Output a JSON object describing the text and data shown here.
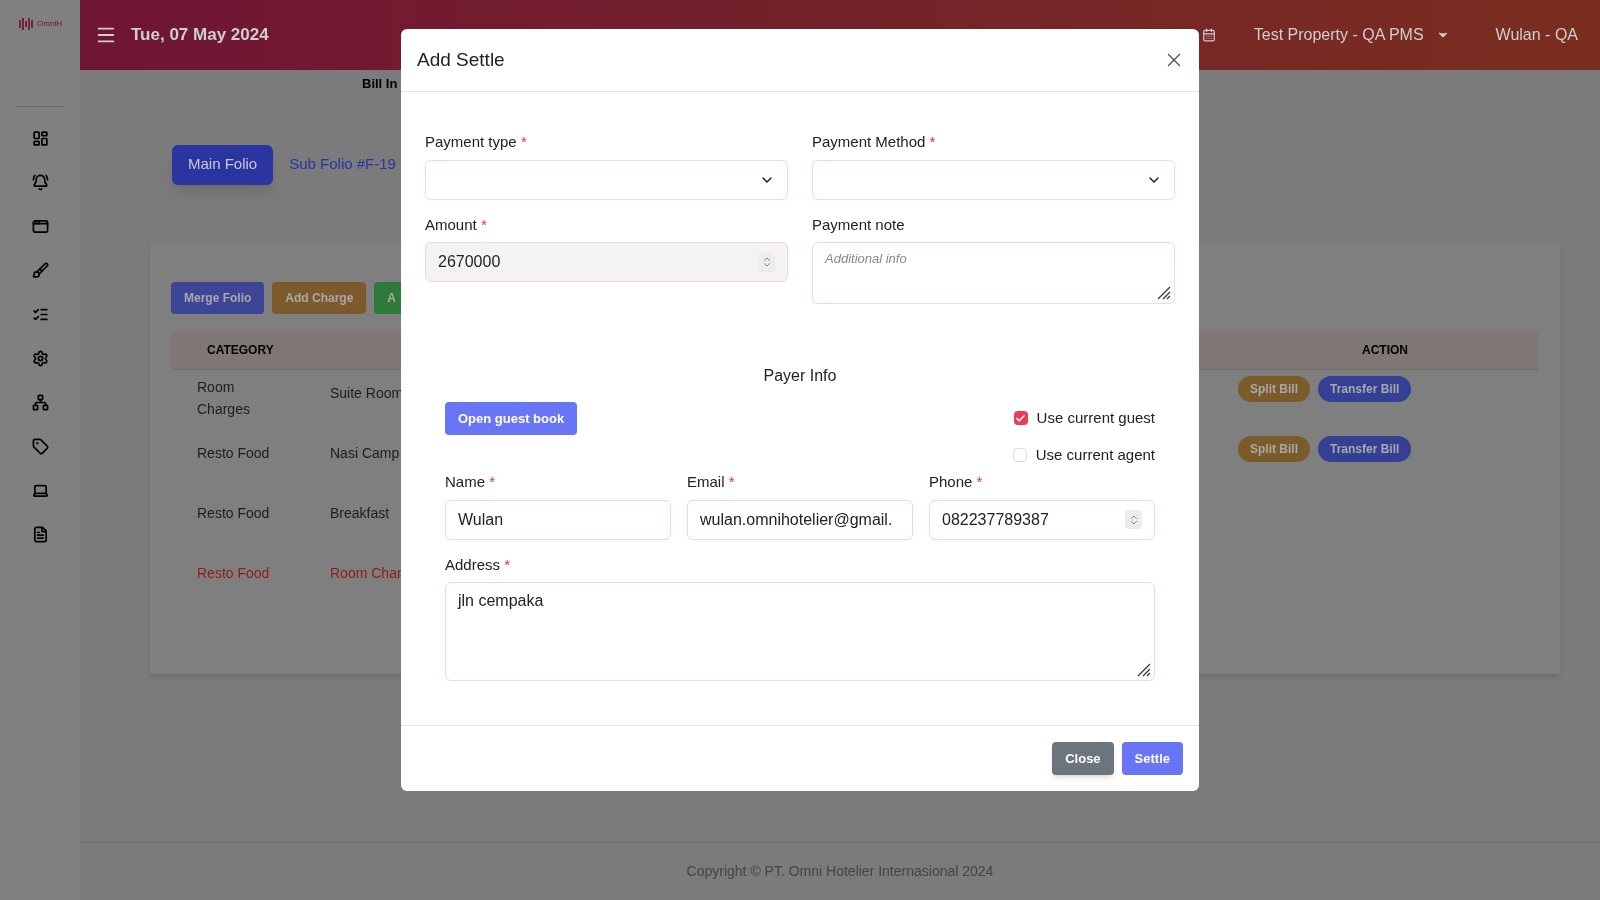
{
  "brand": {
    "logo_text": "OmniH"
  },
  "topbar": {
    "date": "Tue, 07 May 2024",
    "property": "Test Property - QA PMS",
    "user": "Wulan - QA"
  },
  "page": {
    "breadcrumb": "Bill In",
    "folio_tabs": [
      {
        "label": "Main Folio",
        "selected": true
      },
      {
        "label": "Sub Folio #F-19",
        "selected": false
      }
    ],
    "actions": [
      {
        "label": "Merge Folio",
        "color": "#3e4596"
      },
      {
        "label": "Add Charge",
        "color": "#7d5a2c"
      },
      {
        "label": "A",
        "color": "#2e7a3a"
      }
    ],
    "table": {
      "columns": [
        "CATEGORY",
        "ACTION"
      ],
      "rows": [
        {
          "category": "Room Charges",
          "item": "Suite Room",
          "alert": false,
          "actions": [
            {
              "label": "Split Bill",
              "color": "#7b5b2a"
            },
            {
              "label": "Transfer Bill",
              "color": "#353f94"
            }
          ]
        },
        {
          "category": "Resto Food",
          "item": "Nasi Camp",
          "alert": false,
          "actions": [
            {
              "label": "Split Bill",
              "color": "#7b5b2a"
            },
            {
              "label": "Transfer Bill",
              "color": "#353f94"
            }
          ]
        },
        {
          "category": "Resto Food",
          "item": "Breakfast",
          "alert": false,
          "actions": []
        },
        {
          "category": "Resto Food",
          "item": "Room Char",
          "alert": true,
          "actions": []
        }
      ]
    }
  },
  "modal": {
    "title": "Add Settle",
    "fields": [
      {
        "kind": "select",
        "label": "Payment type",
        "mark": "*"
      },
      {
        "kind": "select",
        "label": "Payment Method",
        "mark": "*"
      },
      {
        "kind": "number",
        "label": "Amount",
        "mark": "*",
        "value": "2670000"
      },
      {
        "kind": "textarea",
        "label": "Payment note",
        "placeholder": "Additional info"
      }
    ],
    "payer": {
      "title": "Payer Info",
      "guest_book_button": "Open guest book",
      "checkboxes": [
        {
          "label": "Use current guest",
          "checked": true
        },
        {
          "label": "Use current agent",
          "checked": false
        }
      ],
      "fields": [
        {
          "kind": "text",
          "label": "Name",
          "mark": "*",
          "value": "Wulan"
        },
        {
          "kind": "text",
          "label": "Email",
          "mark": "*",
          "value": "wulan.omnihotelier@gmail."
        },
        {
          "kind": "number",
          "label": "Phone",
          "mark": "*",
          "value": "082237789387"
        }
      ],
      "address": {
        "label": "Address",
        "mark": "*",
        "value": "jln cempaka"
      }
    },
    "buttons": [
      {
        "label": "Close",
        "kind": "secondary"
      },
      {
        "label": "Settle",
        "kind": "primary"
      }
    ]
  },
  "footer": "Copyright © PT. Omni Hotelier Internasional 2024"
}
